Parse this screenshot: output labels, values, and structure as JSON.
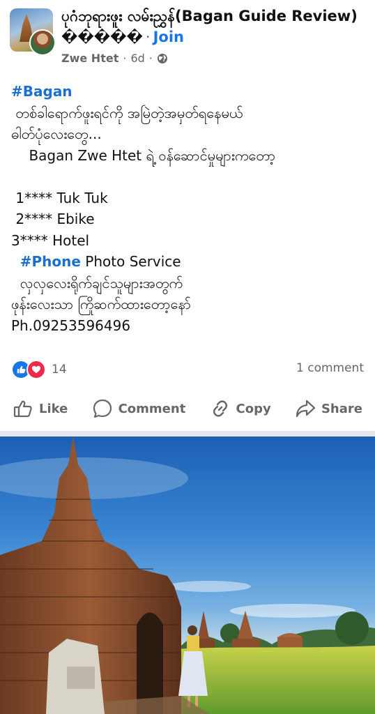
{
  "post": {
    "group_name": "ပုဂံဘုရားဖူး လမ်းညွှန်(Bagan Guide Review) �����",
    "join_label": "Join",
    "author": "Zwe Htet",
    "time": "6d",
    "lines": [
      "#Bagan",
      " တစ်ခါရောက်ဖူးရင်ကို အမြဲတဲ့အမှတ်ရနေမယ်",
      "ဓါတ်ပုံလေးတွေ...",
      "    Bagan Zwe Htet ရဲ့ ဝန်ဆောင်မှုများကတော့",
      "",
      " 1**** Tuk Tuk",
      " 2**** Ebike",
      "3**** Hotel",
      "  #Phone Photo Service",
      "  လှလှလေးရိုက်ချင်သူများအတွက်",
      "ဖုန်းလေးသာ ကြိုဆက်ထားတော့နော်",
      "Ph.09253596496"
    ],
    "reaction_count": "14",
    "comment_count": "1 comment"
  },
  "actions": {
    "like": "Like",
    "comment": "Comment",
    "copy": "Copy",
    "share": "Share"
  },
  "colors": {
    "accent": "#1b74e4",
    "hashtag": "#1b6fcf",
    "secondary_text": "#65676b",
    "love": "#f02849"
  },
  "icons": [
    "globe-icon",
    "like-reaction-icon",
    "love-reaction-icon",
    "like-icon",
    "comment-icon",
    "copy-icon",
    "share-icon"
  ]
}
